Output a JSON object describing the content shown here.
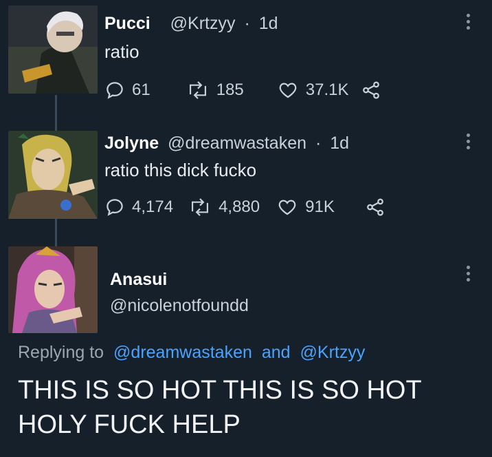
{
  "tweets": [
    {
      "name": "Pucci",
      "handle": "@Krtzyy",
      "separator": "·",
      "time": "1d",
      "text": "ratio",
      "replies": "61",
      "retweets": "185",
      "likes": "37.1K"
    },
    {
      "name": "Jolyne",
      "handle": "@dreamwastaken",
      "separator": "·",
      "time": "1d",
      "text": "ratio this dick fucko",
      "replies": "4,174",
      "retweets": "4,880",
      "likes": "91K"
    }
  ],
  "reply": {
    "name": "Anasui",
    "handle": "@nicolenotfoundd",
    "replying_prefix": "Replying to",
    "replying_user1": "@dreamwastaken",
    "replying_and": "and",
    "replying_user2": "@Krtzyy",
    "text_line1": "THIS IS SO HOT THIS IS SO HOT",
    "text_line2": "HOLY FUCK HELP"
  },
  "icons": {
    "reply": "reply-icon",
    "retweet": "retweet-icon",
    "like": "heart-icon",
    "share": "share-icon",
    "more": "more-icon"
  },
  "colors": {
    "background": "#16202a",
    "mention": "#4aa3ff",
    "muted": "#c9d1d8"
  }
}
